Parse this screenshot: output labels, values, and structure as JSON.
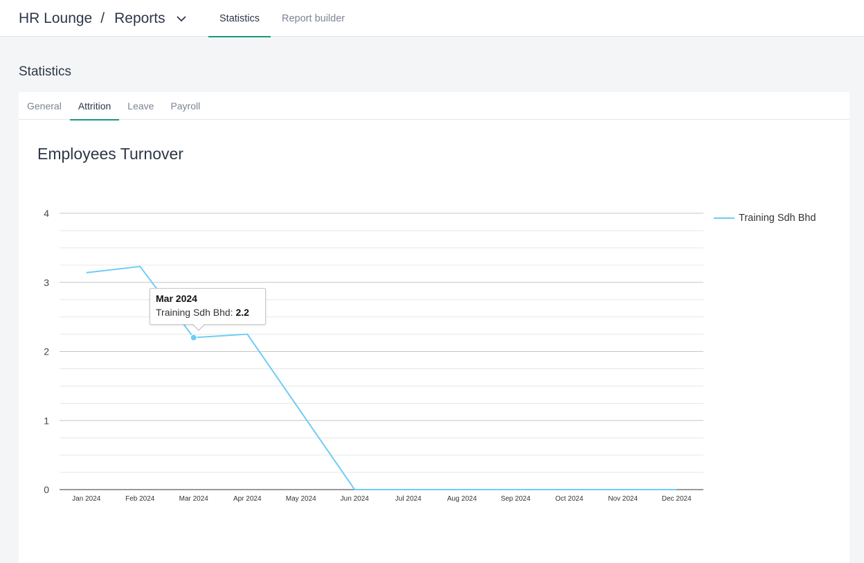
{
  "header": {
    "app_name": "HR Lounge",
    "separator": "/",
    "section": "Reports",
    "tabs": [
      {
        "label": "Statistics",
        "active": true
      },
      {
        "label": "Report builder",
        "active": false
      }
    ]
  },
  "page": {
    "title": "Statistics",
    "subtabs": [
      {
        "label": "General",
        "active": false
      },
      {
        "label": "Attrition",
        "active": true
      },
      {
        "label": "Leave",
        "active": false
      },
      {
        "label": "Payroll",
        "active": false
      }
    ]
  },
  "chart_title": "Employees Turnover",
  "tooltip": {
    "title": "Mar 2024",
    "series": "Training Sdh Bhd",
    "value": "2.2"
  },
  "colors": {
    "accent": "#179a7c",
    "series": "#6cccf5"
  },
  "chart_data": {
    "type": "line",
    "categories": [
      "Jan 2024",
      "Feb 2024",
      "Mar 2024",
      "Apr 2024",
      "May 2024",
      "Jun 2024",
      "Jul 2024",
      "Aug 2024",
      "Sep 2024",
      "Oct 2024",
      "Nov 2024",
      "Dec 2024"
    ],
    "series": [
      {
        "name": "Training Sdh Bhd",
        "values": [
          3.14,
          3.23,
          2.2,
          2.25,
          null,
          0,
          0,
          0,
          0,
          0,
          0,
          0
        ]
      }
    ],
    "y_ticks": [
      0,
      1,
      2,
      3,
      4
    ],
    "ylim": [
      0,
      4
    ],
    "grid": true,
    "legend_position": "right"
  }
}
